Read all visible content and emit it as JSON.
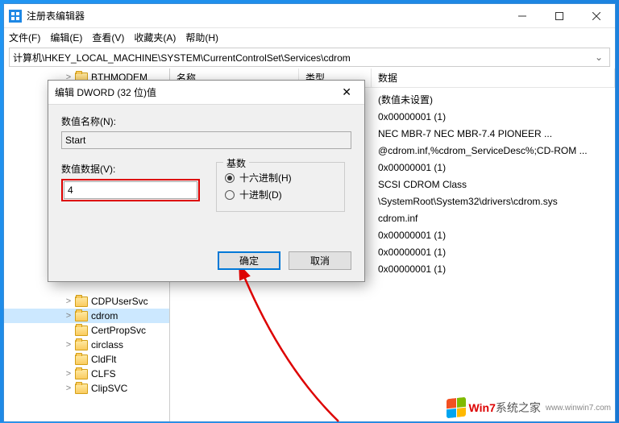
{
  "window": {
    "title": "注册表编辑器"
  },
  "menu": {
    "file": "文件(F)",
    "edit": "编辑(E)",
    "view": "查看(V)",
    "favorites": "收藏夹(A)",
    "help": "帮助(H)"
  },
  "address": {
    "path": "计算机\\HKEY_LOCAL_MACHINE\\SYSTEM\\CurrentControlSet\\Services\\cdrom"
  },
  "tree": {
    "items": [
      {
        "label": "BTHMODEM",
        "expander": ">"
      },
      {
        "label": "CDPUserSvc",
        "expander": ">"
      },
      {
        "label": "cdrom",
        "expander": ">",
        "selected": true
      },
      {
        "label": "CertPropSvc",
        "expander": ""
      },
      {
        "label": "circlass",
        "expander": ">"
      },
      {
        "label": "CldFlt",
        "expander": ""
      },
      {
        "label": "CLFS",
        "expander": ">"
      },
      {
        "label": "ClipSVC",
        "expander": ">"
      }
    ]
  },
  "list": {
    "cols": {
      "name": "名称",
      "type": "类型",
      "data": "数据"
    },
    "rows": [
      {
        "data": "(数值未设置)"
      },
      {
        "data": "0x00000001 (1)"
      },
      {
        "data": "NEC     MBR-7    NEC     MBR-7.4  PIONEER ..."
      },
      {
        "data": "@cdrom.inf,%cdrom_ServiceDesc%;CD-ROM ..."
      },
      {
        "data": "0x00000001 (1)"
      },
      {
        "data": "SCSI CDROM Class"
      },
      {
        "data": "\\SystemRoot\\System32\\drivers\\cdrom.sys"
      },
      {
        "data": "cdrom.inf"
      },
      {
        "data": "0x00000001 (1)"
      },
      {
        "data": "0x00000001 (1)"
      },
      {
        "data": "0x00000001 (1)"
      }
    ]
  },
  "dialog": {
    "title": "编辑 DWORD (32 位)值",
    "name_label": "数值名称(N):",
    "name_value": "Start",
    "value_label": "数值数据(V):",
    "value_value": "4",
    "radix_legend": "基数",
    "radix_hex": "十六进制(H)",
    "radix_dec": "十进制(D)",
    "ok": "确定",
    "cancel": "取消"
  },
  "watermark": {
    "brand_prefix": "Win7",
    "brand_suffix": "系统之家",
    "url": "www.winwin7.com"
  }
}
